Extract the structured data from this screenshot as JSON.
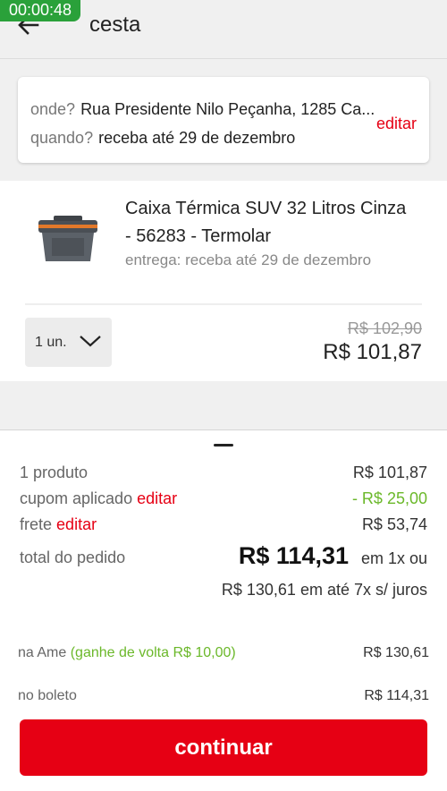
{
  "status": {
    "timer": "00:00:48"
  },
  "appbar": {
    "title": "cesta",
    "back_icon": "arrow-left-icon"
  },
  "address": {
    "where_label": "onde?",
    "where_value": "Rua Presidente Nilo Peçanha, 1285 Ca...",
    "when_label": "quando?",
    "when_value": "receba até 29 de dezembro",
    "edit_label": "editar"
  },
  "product": {
    "name": "Caixa Térmica SUV 32 Litros Cinza - 56283 - Termolar",
    "delivery": "entrega: receba até 29 de dezembro",
    "quantity": "1 un.",
    "old_price": "R$ 102,90",
    "price": "R$ 101,87"
  },
  "summary": {
    "products_label": "1 produto",
    "products_value": "R$ 101,87",
    "coupon_label": "cupom aplicado",
    "coupon_edit": "editar",
    "coupon_value": "- R$ 25,00",
    "shipping_label": "frete",
    "shipping_edit": "editar",
    "shipping_value": "R$ 53,74",
    "total_label": "total do pedido",
    "total_value": "R$ 114,31",
    "total_suffix": "em 1x ou",
    "installments": "R$ 130,61 em até 7x s/ juros"
  },
  "payment": {
    "ame_label": "na Ame",
    "ame_hint": "(ganhe de volta R$ 10,00)",
    "ame_value": "R$ 130,61",
    "boleto_label": "no boleto",
    "boleto_value": "R$ 114,31"
  },
  "cta": {
    "label": "continuar"
  },
  "colors": {
    "brand_red": "#e60014",
    "discount_green": "#6bb82a",
    "timer_green": "#2aa13a"
  }
}
